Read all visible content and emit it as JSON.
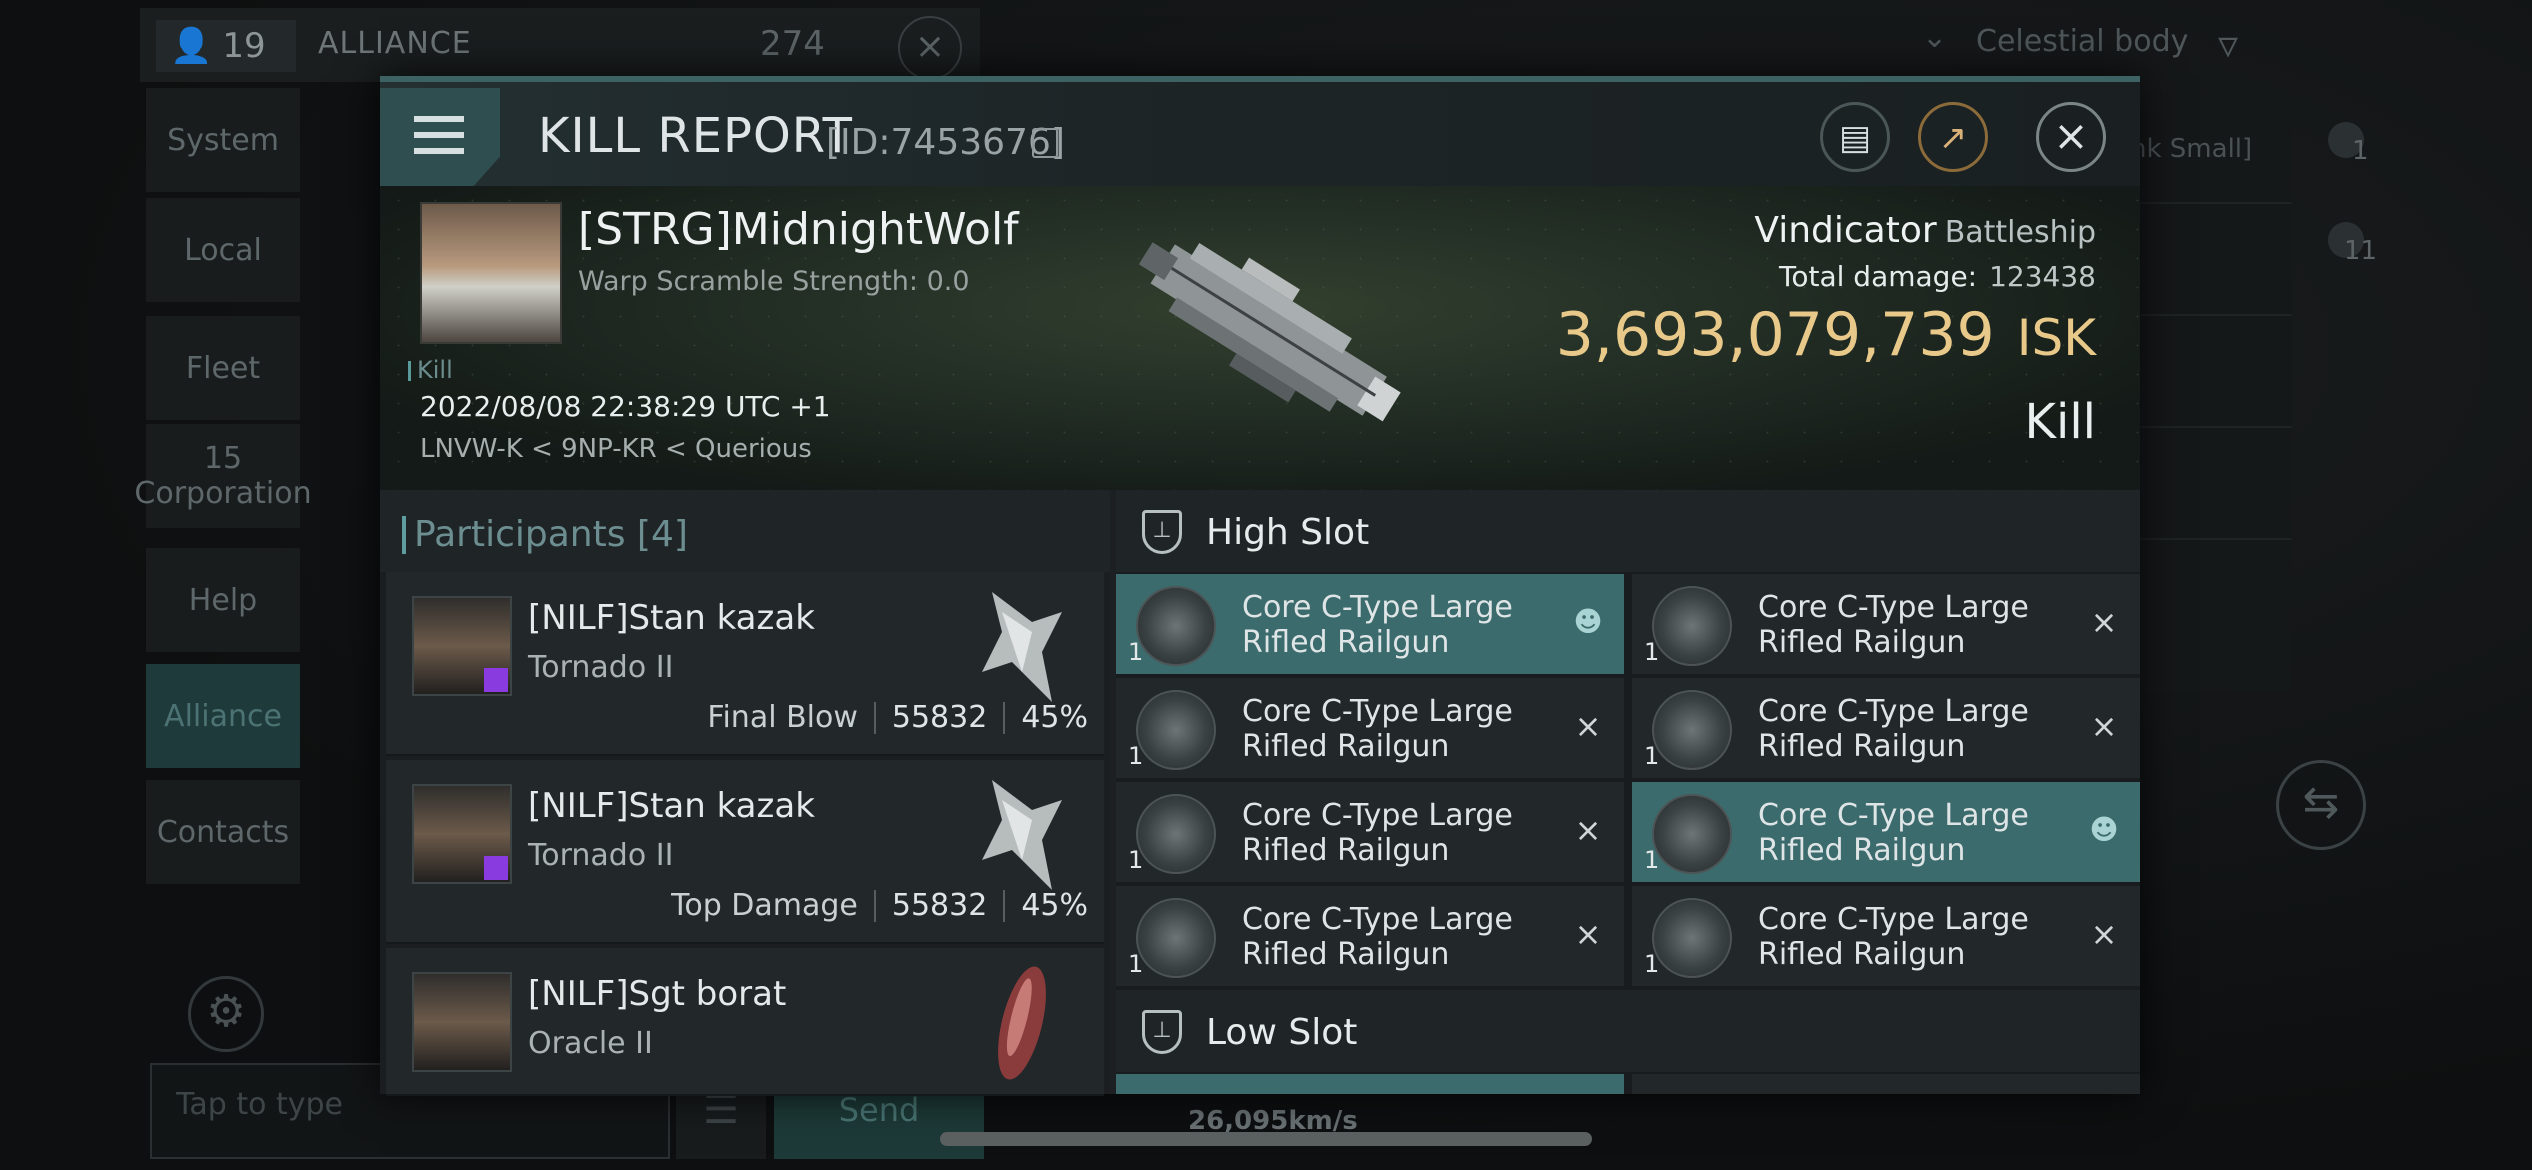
{
  "background": {
    "member_count": "19",
    "channel": "ALLIANCE",
    "channel_count": "274",
    "sidebar": [
      {
        "label": "System"
      },
      {
        "label": "Local"
      },
      {
        "label": "Fleet"
      },
      {
        "label": "15"
      },
      {
        "label": "Corporation"
      },
      {
        "label": "Help"
      },
      {
        "label": "Alliance"
      },
      {
        "label": "Contacts"
      }
    ],
    "input_placeholder": "Tap to type",
    "send_label": "Send",
    "filter_label": "Celestial body",
    "right_snippet": "nk Small]",
    "right_num1": "1",
    "right_num2": "11",
    "speed": "26,095km/s"
  },
  "kill_report": {
    "title": "KILL REPORT",
    "id": "[ID:7453676]",
    "victim": {
      "name": "[STRG]MidnightWolf",
      "scramble": "Warp Scramble Strength: 0.0",
      "tag": "Kill",
      "datetime": "2022/08/08 22:38:29 UTC +1",
      "location": "LNVW-K < 9NP-KR < Querious"
    },
    "ship": {
      "name": "Vindicator",
      "class": "Battleship",
      "total_damage_label": "Total damage:",
      "total_damage": "123438",
      "isk_value": "3,693,079,739",
      "isk_unit": "ISK",
      "result": "Kill"
    },
    "participants_title": "Participants",
    "participants_count": "[4]",
    "participants": [
      {
        "name": "[NILF]Stan kazak",
        "ship": "Tornado II",
        "role": "Final Blow",
        "damage": "55832",
        "pct": "45%"
      },
      {
        "name": "[NILF]Stan kazak",
        "ship": "Tornado II",
        "role": "Top Damage",
        "damage": "55832",
        "pct": "45%"
      },
      {
        "name": "[NILF]Sgt borat",
        "ship": "Oracle II",
        "role": "",
        "damage": "",
        "pct": ""
      }
    ],
    "high_slot_title": "High Slot",
    "low_slot_title": "Low Slot",
    "high_slots": [
      {
        "name": "Core C-Type Large Rifled Railgun",
        "qty": "1",
        "state": "pilot"
      },
      {
        "name": "Core C-Type Large Rifled Railgun",
        "qty": "1",
        "state": "destroyed"
      },
      {
        "name": "Core C-Type Large Rifled Railgun",
        "qty": "1",
        "state": "destroyed"
      },
      {
        "name": "Core C-Type Large Rifled Railgun",
        "qty": "1",
        "state": "destroyed"
      },
      {
        "name": "Core C-Type Large Rifled Railgun",
        "qty": "1",
        "state": "destroyed"
      },
      {
        "name": "Core C-Type Large Rifled Railgun",
        "qty": "1",
        "state": "pilot"
      },
      {
        "name": "Core C-Type Large Rifled Railgun",
        "qty": "1",
        "state": "destroyed"
      },
      {
        "name": "Core C-Type Large Rifled Railgun",
        "qty": "1",
        "state": "destroyed"
      }
    ]
  }
}
